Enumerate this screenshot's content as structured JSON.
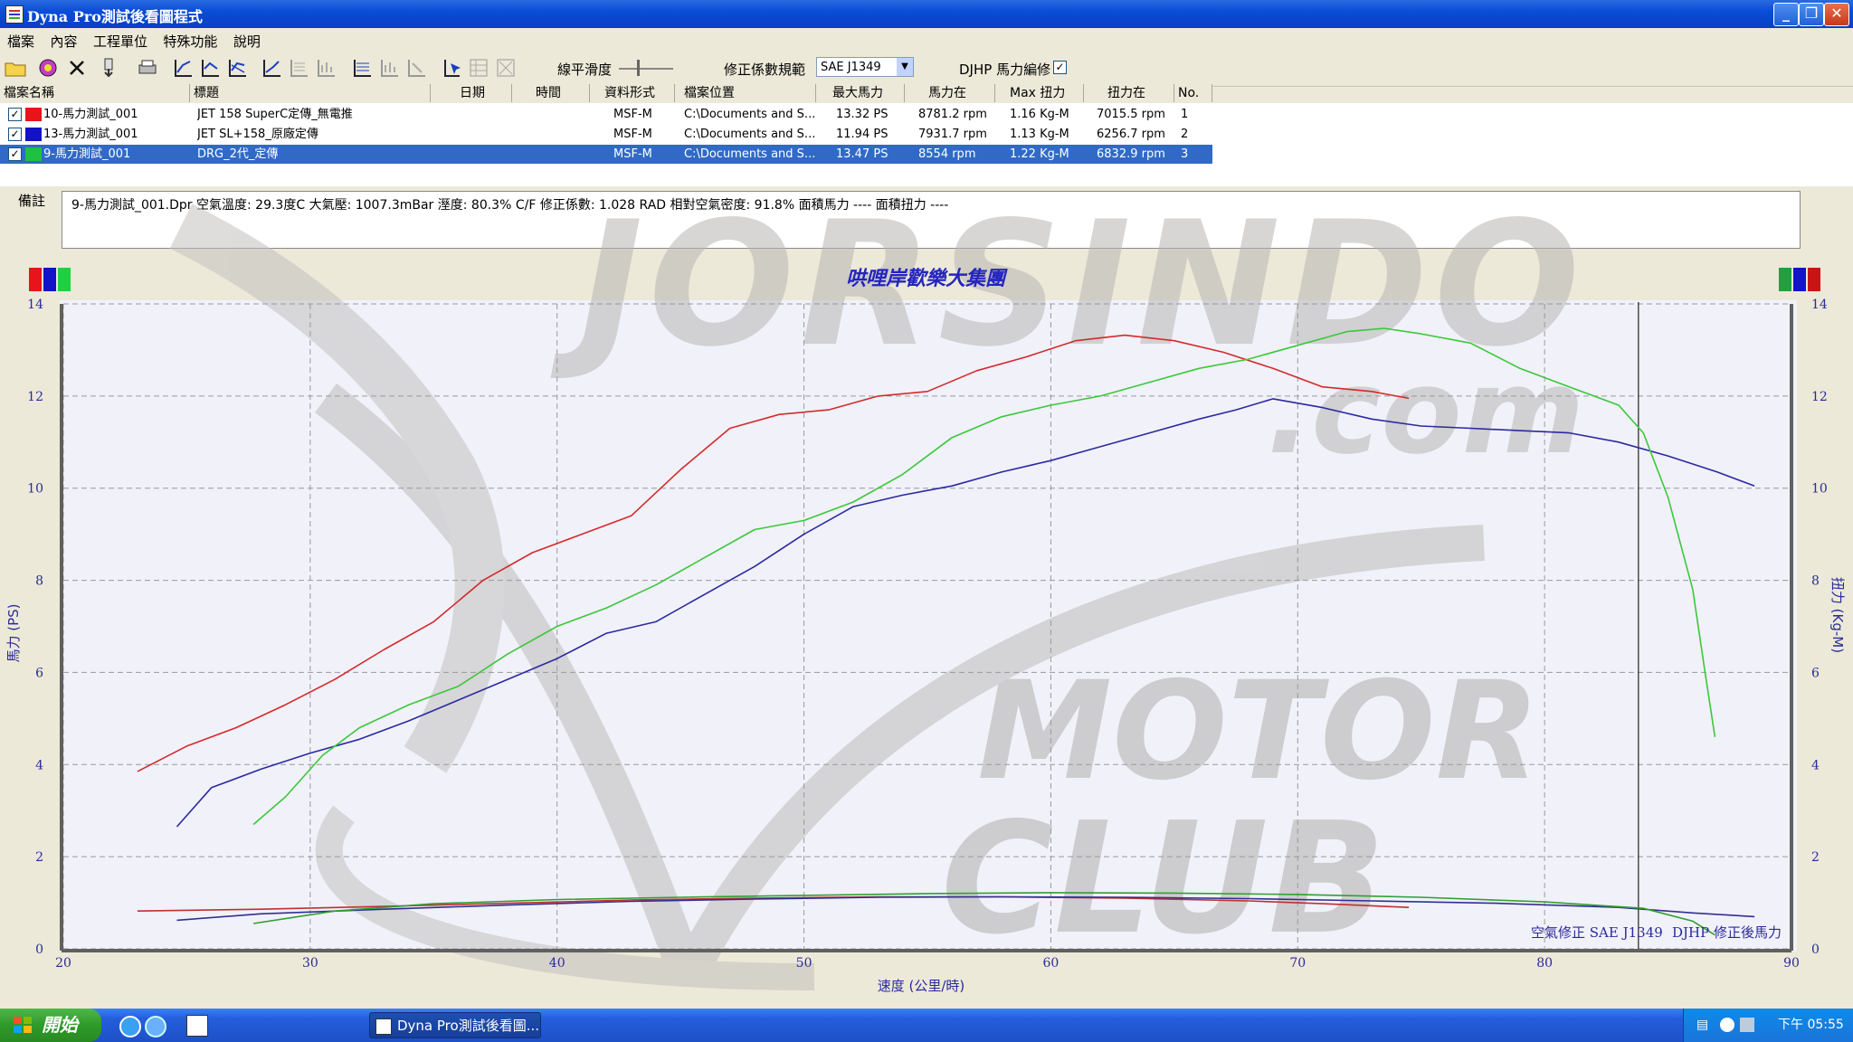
{
  "window": {
    "title": "Dyna Pro測試後看圖程式"
  },
  "menu": [
    "檔案",
    "內容",
    "工程單位",
    "特殊功能",
    "說明"
  ],
  "toolbar": {
    "smooth_label": "線平滑度",
    "correction_label": "修正係數規範",
    "correction_value": "SAE J1349",
    "djhp_label": "DJHP 馬力編修",
    "djhp_checked": "✓"
  },
  "file_table": {
    "headers": [
      "檔案名稱",
      "標題",
      "日期",
      "時間",
      "資料形式",
      "檔案位置",
      "最大馬力",
      "馬力在",
      "Max 扭力",
      "扭力在",
      "No."
    ],
    "rows": [
      {
        "name": "10-馬力測試_001",
        "title": "JET 158 SuperC定傳_無電推",
        "date": "",
        "time": "",
        "format": "MSF-M",
        "location": "C:\\Documents and S...",
        "max_hp": "13.32 PS",
        "hp_at": "8781.2 rpm",
        "max_torque": "1.16 Kg-M",
        "torque_at": "7015.5 rpm",
        "no": "1",
        "color": "#e8141c"
      },
      {
        "name": "13-馬力測試_001",
        "title": "JET SL+158_原廠定傳",
        "date": "",
        "time": "",
        "format": "MSF-M",
        "location": "C:\\Documents and S...",
        "max_hp": "11.94 PS",
        "hp_at": "7931.7 rpm",
        "max_torque": "1.13 Kg-M",
        "torque_at": "6256.7 rpm",
        "no": "2",
        "color": "#1212c8"
      },
      {
        "name": "9-馬力測試_001",
        "title": "DRG_2代_定傳",
        "date": "",
        "time": "",
        "format": "MSF-M",
        "location": "C:\\Documents and S...",
        "max_hp": "13.47 PS",
        "hp_at": "8554 rpm",
        "max_torque": "1.22 Kg-M",
        "torque_at": "6832.9 rpm",
        "no": "3",
        "color": "#20c040"
      }
    ]
  },
  "note": {
    "label": "備註",
    "text": "9-馬力測試_001.Dpr  空氣溫度: 29.3度C  大氣壓: 1007.3mBar  溼度: 80.3%  C/F 修正係數: 1.028  RAD 相對空氣密度: 91.8%  面積馬力 ----  面積扭力 ----"
  },
  "chart_data": {
    "type": "line",
    "title": "哄哩岸歡樂大集團",
    "xlabel": "速度 (公里/時)",
    "ylabel": "馬力 (PS)",
    "y2label": "扭力 (Kg-M)",
    "xlim": [
      20,
      90
    ],
    "ylim": [
      0,
      14
    ],
    "x_ticks": [
      20,
      30,
      40,
      50,
      60,
      70,
      80,
      90
    ],
    "y_ticks": [
      0,
      2,
      4,
      6,
      8,
      10,
      12,
      14
    ],
    "grid": true,
    "cursor_x": 83.8,
    "footer_left": "空氣修正 SAE J1349",
    "footer_right": "DJHP 修正後馬力",
    "series": [
      {
        "name": "10-馬力測試_001",
        "color": "#d42a2a",
        "kind": "power",
        "x": [
          23,
          25,
          27,
          29,
          31,
          33,
          35,
          37,
          39,
          41,
          43,
          45,
          47,
          49,
          51,
          53,
          55,
          57,
          59,
          61,
          63,
          65,
          67,
          69,
          71,
          73,
          74.5
        ],
        "y": [
          3.85,
          4.4,
          4.8,
          5.3,
          5.85,
          6.5,
          7.1,
          8,
          8.6,
          9,
          9.4,
          10.4,
          11.3,
          11.6,
          11.7,
          12,
          12.1,
          12.55,
          12.85,
          13.2,
          13.32,
          13.2,
          12.95,
          12.6,
          12.2,
          12.1,
          11.95
        ]
      },
      {
        "name": "13-馬力測試_001",
        "color": "#2a2aa0",
        "kind": "power",
        "x": [
          24.6,
          26,
          28,
          30,
          32,
          34,
          36,
          38,
          40,
          42,
          44,
          46,
          48,
          50,
          52,
          54,
          56,
          58,
          60,
          62,
          64,
          66,
          67.5,
          69,
          71,
          73,
          75,
          77,
          79,
          81,
          83,
          85,
          87,
          88.5
        ],
        "y": [
          2.65,
          3.5,
          3.9,
          4.25,
          4.55,
          4.95,
          5.4,
          5.85,
          6.3,
          6.85,
          7.1,
          7.7,
          8.3,
          9,
          9.6,
          9.85,
          10.05,
          10.35,
          10.6,
          10.9,
          11.2,
          11.5,
          11.7,
          11.94,
          11.75,
          11.5,
          11.35,
          11.3,
          11.25,
          11.2,
          11.0,
          10.7,
          10.35,
          10.05
        ]
      },
      {
        "name": "9-馬力測試_001",
        "color": "#3ac83a",
        "kind": "power",
        "x": [
          27.7,
          29,
          30.5,
          32,
          34,
          36,
          38,
          40,
          42,
          44,
          46,
          48,
          50,
          52,
          54,
          56,
          58,
          60,
          62,
          64,
          66,
          68,
          70,
          72,
          73.5,
          75,
          77,
          79,
          81,
          83,
          84,
          85,
          86,
          86.5,
          86.9
        ],
        "y": [
          2.7,
          3.3,
          4.2,
          4.8,
          5.3,
          5.7,
          6.4,
          7.0,
          7.4,
          7.9,
          8.5,
          9.1,
          9.3,
          9.7,
          10.3,
          11.1,
          11.55,
          11.8,
          12.0,
          12.3,
          12.6,
          12.8,
          13.1,
          13.4,
          13.47,
          13.35,
          13.15,
          12.6,
          12.2,
          11.8,
          11.2,
          9.8,
          7.8,
          6.0,
          4.6
        ]
      },
      {
        "name": "10-馬力測試_001",
        "color": "#c03030",
        "kind": "torque",
        "x": [
          23,
          28,
          33,
          38,
          43,
          48,
          53,
          58,
          63,
          68,
          71,
          74.5
        ],
        "y": [
          0.82,
          0.86,
          0.92,
          0.99,
          1.06,
          1.1,
          1.13,
          1.13,
          1.1,
          1.04,
          0.98,
          0.9
        ]
      },
      {
        "name": "13-馬力測試_001",
        "color": "#303090",
        "kind": "torque",
        "x": [
          24.6,
          28,
          33,
          38,
          43,
          48,
          53,
          58,
          63,
          68,
          73,
          78,
          83,
          86,
          88.5
        ],
        "y": [
          0.62,
          0.76,
          0.86,
          0.95,
          1.03,
          1.08,
          1.12,
          1.13,
          1.12,
          1.09,
          1.04,
          0.99,
          0.9,
          0.78,
          0.7
        ]
      },
      {
        "name": "9-馬力測試_001",
        "color": "#30a030",
        "kind": "torque",
        "x": [
          27.7,
          31,
          35,
          40,
          45,
          50,
          55,
          60,
          65,
          70,
          75,
          80,
          84,
          86,
          86.9
        ],
        "y": [
          0.55,
          0.82,
          0.98,
          1.07,
          1.12,
          1.16,
          1.2,
          1.22,
          1.21,
          1.18,
          1.12,
          1.02,
          0.88,
          0.6,
          0.3
        ]
      }
    ]
  },
  "taskbar": {
    "start": "開始",
    "task_title": "Dyna Pro測試後看圖...",
    "clock": "下午 05:55"
  }
}
